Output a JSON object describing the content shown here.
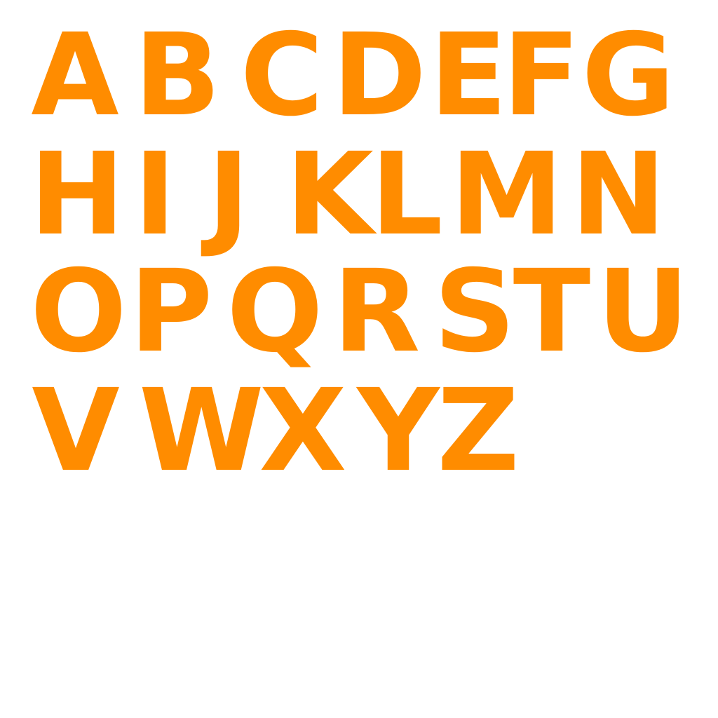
{
  "accent_color": "#ff8c00",
  "rows": [
    [
      "A",
      "B",
      "C",
      "D",
      "E",
      "F",
      "G"
    ],
    [
      "H",
      "I",
      "J",
      "K",
      "L",
      "M",
      "N"
    ],
    [
      "O",
      "P",
      "Q",
      "R",
      "S",
      "T",
      "U"
    ],
    [
      "V",
      "W",
      "X",
      "Y",
      "Z"
    ]
  ]
}
